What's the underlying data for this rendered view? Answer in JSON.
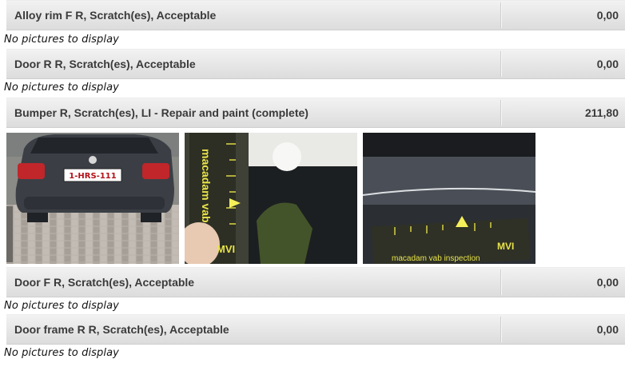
{
  "items": [
    {
      "description": "Alloy rim F R, Scratch(es), Acceptable",
      "amount": "0,00",
      "pictures_text": "No pictures to display"
    },
    {
      "description": "Door R R, Scratch(es), Acceptable",
      "amount": "0,00",
      "pictures_text": "No pictures to display"
    },
    {
      "description": "Bumper R, Scratch(es), LI - Repair and paint (complete)",
      "amount": "211,80"
    },
    {
      "description": "Door F R, Scratch(es), Acceptable",
      "amount": "0,00",
      "pictures_text": "No pictures to display"
    },
    {
      "description": "Door frame R R, Scratch(es), Acceptable",
      "amount": "0,00",
      "pictures_text": "No pictures to display"
    }
  ],
  "photos": {
    "car_rear_plate": "1-HRS-111",
    "ruler_text": "macadam vab inspection",
    "logo_text": "MVI"
  }
}
